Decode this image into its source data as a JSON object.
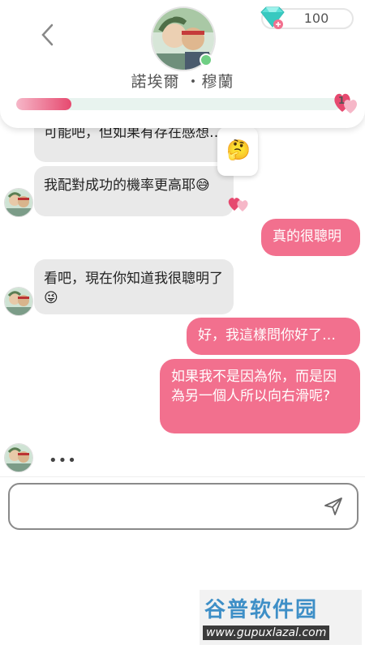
{
  "header": {
    "contact_name": "諾埃爾 ・穆蘭",
    "gems": "100",
    "hearts": "1",
    "affinity_progress": 0.17
  },
  "messages": [
    {
      "text": "可能吧，但如果有存在感想…"
    },
    {
      "text": "我配對成功的機率更高耶😅"
    },
    {
      "text": "真的很聰明"
    },
    {
      "text": "看吧，現在你知道我很聰明了😜"
    },
    {
      "text": "好，我這樣問你好了…"
    },
    {
      "text": "如果我不是因為你，而是因為另一個人所以向右滑呢?"
    }
  ],
  "typing_indicator": "•••",
  "reaction_emoji": "🤔",
  "input": {
    "placeholder": ""
  },
  "watermark": {
    "line1": "谷普软件园",
    "line2": "www.gupuxlazal.com"
  },
  "colors": {
    "outgoing_bubble": "#f2708e",
    "incoming_bubble": "#e9e9e9",
    "accent": "#e6496f"
  }
}
